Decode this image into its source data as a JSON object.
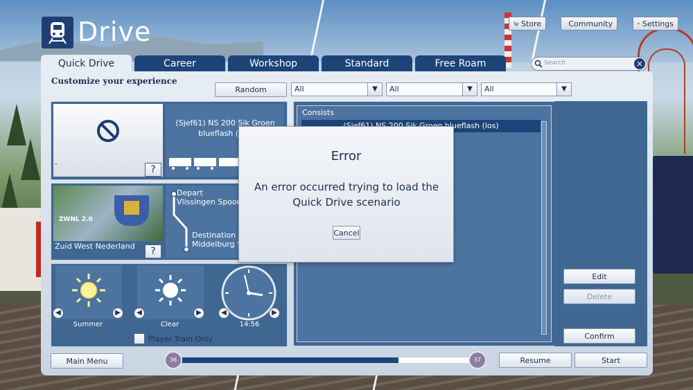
{
  "app": {
    "title": "Drive"
  },
  "top_buttons": {
    "store": "Store",
    "community": "Community",
    "settings": "Settings"
  },
  "tabs": [
    {
      "label": "Quick Drive",
      "active": true
    },
    {
      "label": "Career"
    },
    {
      "label": "Workshop"
    },
    {
      "label": "Standard"
    },
    {
      "label": "Free Roam"
    }
  ],
  "search": {
    "placeholder": "Search"
  },
  "customize": {
    "heading": "Customize your experience",
    "random_label": "Random"
  },
  "filters": [
    {
      "value": "All"
    },
    {
      "value": "All"
    },
    {
      "value": "All"
    }
  ],
  "selection": {
    "empty_label": "-",
    "train_name": "(Sjef61) NS 200 Sik Groen blueflash (los)",
    "route_name": "Zuid West Nederland",
    "route_logo_text": "ZWNL 2.0",
    "depart_label": "Depart",
    "depart_station": "Vlissingen Spoor 3",
    "destination_label": "Destination",
    "destination_station": "Middelburg Sp",
    "help_label": "?"
  },
  "conditions": {
    "season": "Summer",
    "weather": "Clear",
    "time": "14:56",
    "player_train_only": "Player Train Only"
  },
  "consists": {
    "header": "Consists",
    "items": [
      "(Sjef61) NS 200 Sik Groen blueflash (los)"
    ]
  },
  "actions": {
    "edit": "Edit",
    "delete": "Delete",
    "confirm": "Confirm"
  },
  "bottom": {
    "main_menu": "Main Menu",
    "resume": "Resume",
    "start": "Start",
    "slider_min": "36",
    "slider_max": "37",
    "slider_fill": 0.74
  },
  "dialog": {
    "title": "Error",
    "message": "An error occurred trying to load the Quick Drive scenario",
    "cancel_label": "Cancel"
  },
  "colors": {
    "tab_blue": "#1d4478",
    "panel_blue": "#3f6792",
    "accent_light": "#e7edf4"
  }
}
